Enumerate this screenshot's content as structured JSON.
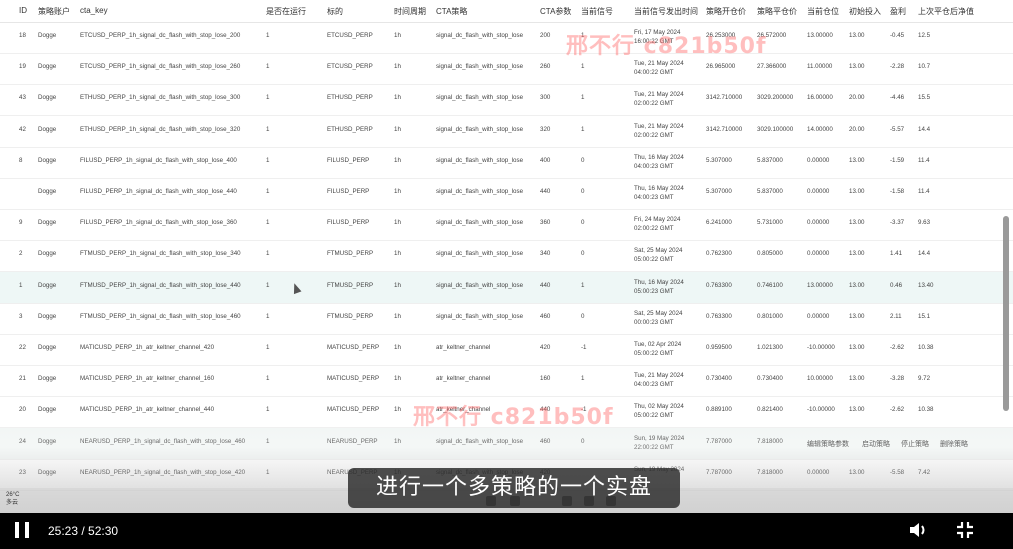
{
  "headers": [
    "ID",
    "策略账户",
    "cta_key",
    "是否在运行",
    "标的",
    "时间周期",
    "CTA策略",
    "CTA参数",
    "当前信号",
    "当前信号发出时间",
    "策略开仓价",
    "策略平仓价",
    "当前仓位",
    "初始投入",
    "盈利",
    "上次平仓后净值"
  ],
  "rows": [
    {
      "id": "18",
      "acct": "Dogge",
      "key": "ETCUSD_PERP_1h_signal_dc_flash_with_stop_lose_200",
      "run": "1",
      "sym": "ETCUSD_PERP",
      "tf": "1h",
      "strat": "signal_dc_flash_with_stop_lose",
      "param": "200",
      "sig": "1",
      "date": "Fri, 17 May 2024 16:00:22 GMT",
      "open": "26.253000",
      "close": "26.572000",
      "pos": "13.00000",
      "init": "13.00",
      "pnl": "-0.45",
      "nav": "12.5"
    },
    {
      "id": "19",
      "acct": "Dogge",
      "key": "ETCUSD_PERP_1h_signal_dc_flash_with_stop_lose_260",
      "run": "1",
      "sym": "ETCUSD_PERP",
      "tf": "1h",
      "strat": "signal_dc_flash_with_stop_lose",
      "param": "260",
      "sig": "1",
      "date": "Tue, 21 May 2024 04:00:22 GMT",
      "open": "26.965000",
      "close": "27.366000",
      "pos": "11.00000",
      "init": "13.00",
      "pnl": "-2.28",
      "nav": "10.7"
    },
    {
      "id": "43",
      "acct": "Dogge",
      "key": "ETHUSD_PERP_1h_signal_dc_flash_with_stop_lose_300",
      "run": "1",
      "sym": "ETHUSD_PERP",
      "tf": "1h",
      "strat": "signal_dc_flash_with_stop_lose",
      "param": "300",
      "sig": "1",
      "date": "Tue, 21 May 2024 02:00:22 GMT",
      "open": "3142.710000",
      "close": "3029.200000",
      "pos": "16.00000",
      "init": "20.00",
      "pnl": "-4.46",
      "nav": "15.5"
    },
    {
      "id": "42",
      "acct": "Dogge",
      "key": "ETHUSD_PERP_1h_signal_dc_flash_with_stop_lose_320",
      "run": "1",
      "sym": "ETHUSD_PERP",
      "tf": "1h",
      "strat": "signal_dc_flash_with_stop_lose",
      "param": "320",
      "sig": "1",
      "date": "Tue, 21 May 2024 02:00:22 GMT",
      "open": "3142.710000",
      "close": "3029.100000",
      "pos": "14.00000",
      "init": "20.00",
      "pnl": "-5.57",
      "nav": "14.4"
    },
    {
      "id": "8",
      "acct": "Dogge",
      "key": "FILUSD_PERP_1h_signal_dc_flash_with_stop_lose_400",
      "run": "1",
      "sym": "FILUSD_PERP",
      "tf": "1h",
      "strat": "signal_dc_flash_with_stop_lose",
      "param": "400",
      "sig": "0",
      "date": "Thu, 16 May 2024 04:00:23 GMT",
      "open": "5.307000",
      "close": "5.837000",
      "pos": "0.00000",
      "init": "13.00",
      "pnl": "-1.59",
      "nav": "11.4"
    },
    {
      "id": "",
      "acct": "Dogge",
      "key": "FILUSD_PERP_1h_signal_dc_flash_with_stop_lose_440",
      "run": "1",
      "sym": "FILUSD_PERP",
      "tf": "1h",
      "strat": "signal_dc_flash_with_stop_lose",
      "param": "440",
      "sig": "0",
      "date": "Thu, 16 May 2024 04:00:23 GMT",
      "open": "5.307000",
      "close": "5.837000",
      "pos": "0.00000",
      "init": "13.00",
      "pnl": "-1.58",
      "nav": "11.4"
    },
    {
      "id": "9",
      "acct": "Dogge",
      "key": "FILUSD_PERP_1h_signal_dc_flash_with_stop_lose_360",
      "run": "1",
      "sym": "FILUSD_PERP",
      "tf": "1h",
      "strat": "signal_dc_flash_with_stop_lose",
      "param": "360",
      "sig": "0",
      "date": "Fri, 24 May 2024 02:00:22 GMT",
      "open": "6.241000",
      "close": "5.731000",
      "pos": "0.00000",
      "init": "13.00",
      "pnl": "-3.37",
      "nav": "9.63"
    },
    {
      "id": "2",
      "acct": "Dogge",
      "key": "FTMUSD_PERP_1h_signal_dc_flash_with_stop_lose_340",
      "run": "1",
      "sym": "FTMUSD_PERP",
      "tf": "1h",
      "strat": "signal_dc_flash_with_stop_lose",
      "param": "340",
      "sig": "0",
      "date": "Sat, 25 May 2024 05:00:22 GMT",
      "open": "0.762300",
      "close": "0.805000",
      "pos": "0.00000",
      "init": "13.00",
      "pnl": "1.41",
      "nav": "14.4"
    },
    {
      "id": "1",
      "acct": "Dogge",
      "key": "FTMUSD_PERP_1h_signal_dc_flash_with_stop_lose_440",
      "run": "1",
      "sym": "FTMUSD_PERP",
      "tf": "1h",
      "strat": "signal_dc_flash_with_stop_lose",
      "param": "440",
      "sig": "1",
      "date": "Thu, 16 May 2024 05:00:23 GMT",
      "open": "0.763300",
      "close": "0.746100",
      "pos": "13.00000",
      "init": "13.00",
      "pnl": "0.46",
      "nav": "13.40"
    },
    {
      "id": "3",
      "acct": "Dogge",
      "key": "FTMUSD_PERP_1h_signal_dc_flash_with_stop_lose_460",
      "run": "1",
      "sym": "FTMUSD_PERP",
      "tf": "1h",
      "strat": "signal_dc_flash_with_stop_lose",
      "param": "460",
      "sig": "0",
      "date": "Sat, 25 May 2024 00:00:23 GMT",
      "open": "0.763300",
      "close": "0.801000",
      "pos": "0.00000",
      "init": "13.00",
      "pnl": "2.11",
      "nav": "15.1"
    },
    {
      "id": "22",
      "acct": "Dogge",
      "key": "MATICUSD_PERP_1h_atr_keltner_channel_420",
      "run": "1",
      "sym": "MATICUSD_PERP",
      "tf": "1h",
      "strat": "atr_keltner_channel",
      "param": "420",
      "sig": "-1",
      "date": "Tue, 02 Apr 2024 05:00:22 GMT",
      "open": "0.959500",
      "close": "1.021300",
      "pos": "-10.00000",
      "init": "13.00",
      "pnl": "-2.62",
      "nav": "10.38"
    },
    {
      "id": "21",
      "acct": "Dogge",
      "key": "MATICUSD_PERP_1h_atr_keltner_channel_160",
      "run": "1",
      "sym": "MATICUSD_PERP",
      "tf": "1h",
      "strat": "atr_keltner_channel",
      "param": "160",
      "sig": "1",
      "date": "Tue, 21 May 2024 04:00:23 GMT",
      "open": "0.730400",
      "close": "0.730400",
      "pos": "10.00000",
      "init": "13.00",
      "pnl": "-3.28",
      "nav": "9.72"
    },
    {
      "id": "20",
      "acct": "Dogge",
      "key": "MATICUSD_PERP_1h_atr_keltner_channel_440",
      "run": "1",
      "sym": "MATICUSD_PERP",
      "tf": "1h",
      "strat": "atr_keltner_channel",
      "param": "440",
      "sig": "-1",
      "date": "Thu, 02 May 2024 05:00:22 GMT",
      "open": "0.889100",
      "close": "0.821400",
      "pos": "-10.00000",
      "init": "13.00",
      "pnl": "-2.62",
      "nav": "10.38"
    },
    {
      "id": "24",
      "acct": "Dogge",
      "key": "NEARUSD_PERP_1h_signal_dc_flash_with_stop_lose_460",
      "run": "1",
      "sym": "NEARUSD_PERP",
      "tf": "1h",
      "strat": "signal_dc_flash_with_stop_lose",
      "param": "460",
      "sig": "0",
      "date": "Sun, 19 May 2024 22:00:22 GMT",
      "open": "7.787000",
      "close": "7.818000",
      "pos": "",
      "init": "",
      "pnl": "",
      "nav": ""
    },
    {
      "id": "23",
      "acct": "Dogge",
      "key": "NEARUSD_PERP_1h_signal_dc_flash_with_stop_lose_420",
      "run": "1",
      "sym": "NEARUSD_PERP",
      "tf": "1h",
      "strat": "signal_dc_flash_with_stop_lose",
      "param": "420",
      "sig": "",
      "date": "Sun, 19 May 2024",
      "open": "7.787000",
      "close": "7.818000",
      "pos": "0.00000",
      "init": "13.00",
      "pnl": "-5.58",
      "nav": "7.42"
    }
  ],
  "row_actions": [
    "编辑策略参数",
    "启动策略",
    "停止策略",
    "删除策略"
  ],
  "watermark": "邢不行 c821b50f",
  "subtitle": "进行一个多策略的一个实盘",
  "weather": {
    "temp": "26°C",
    "desc": "多云"
  },
  "player": {
    "time": "25:23 / 52:30"
  },
  "icons": [
    "pause-icon",
    "volume-icon",
    "fullscreen-icon"
  ]
}
